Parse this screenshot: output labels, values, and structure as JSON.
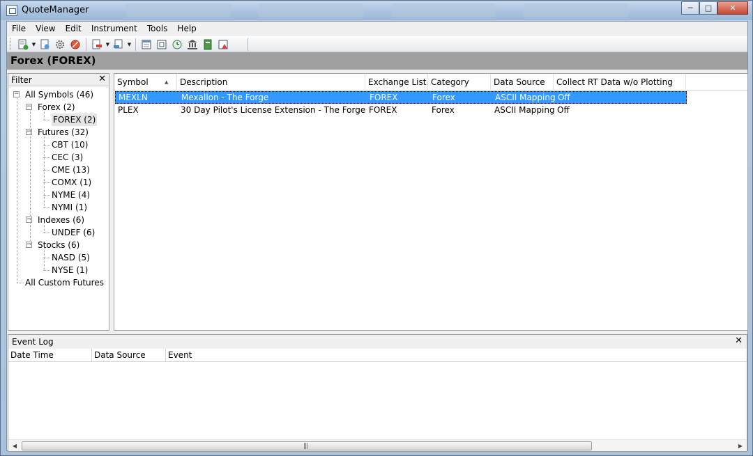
{
  "window": {
    "title": "QuoteManager",
    "minimize": "─",
    "maximize": "□",
    "close": "✕"
  },
  "menu": [
    "File",
    "View",
    "Edit",
    "Instrument",
    "Tools",
    "Help"
  ],
  "toolbar": {
    "icons": [
      "new-symbol-icon",
      "dropdown-arrow",
      "import-icon",
      "settings-gear-icon",
      "stop-icon",
      "export-icon",
      "dropdown-arrow",
      "download-icon",
      "dropdown-arrow",
      "calendar-icon",
      "session-icon",
      "clock-icon",
      "exchange-icon",
      "book-icon",
      "chart-alert-icon"
    ]
  },
  "header": {
    "title": "Forex (FOREX)"
  },
  "filter": {
    "label": "Filter",
    "close": "✕",
    "tree": [
      {
        "label": "All Symbols (46)",
        "level": 0,
        "expander": "−"
      },
      {
        "label": "Forex (2)",
        "level": 1,
        "expander": "−"
      },
      {
        "label": "FOREX (2)",
        "level": 2,
        "selected": true
      },
      {
        "label": "Futures (32)",
        "level": 1,
        "expander": "−"
      },
      {
        "label": "CBT (10)",
        "level": 2
      },
      {
        "label": "CEC (3)",
        "level": 2
      },
      {
        "label": "CME (13)",
        "level": 2
      },
      {
        "label": "COMX (1)",
        "level": 2
      },
      {
        "label": "NYME (4)",
        "level": 2
      },
      {
        "label": "NYMI (1)",
        "level": 2
      },
      {
        "label": "Indexes (6)",
        "level": 1,
        "expander": "−"
      },
      {
        "label": "UNDEF (6)",
        "level": 2
      },
      {
        "label": "Stocks (6)",
        "level": 1,
        "expander": "−"
      },
      {
        "label": "NASD (5)",
        "level": 2
      },
      {
        "label": "NYSE (1)",
        "level": 2
      },
      {
        "label": "All Custom Futures",
        "level": 0
      }
    ]
  },
  "grid": {
    "sort_indicator": "▲",
    "columns": [
      "Symbol",
      "Description",
      "Exchange List...",
      "Category",
      "Data Source",
      "Collect RT Data w/o Plotting"
    ],
    "rows": [
      {
        "cells": [
          "MEXLN",
          "Mexallon - The Forge",
          "FOREX",
          "Forex",
          "ASCII Mapping",
          "Off"
        ],
        "selected": true
      },
      {
        "cells": [
          "PLEX",
          "30 Day Pilot's License Extension - The Forge",
          "FOREX",
          "Forex",
          "ASCII Mapping",
          "Off"
        ],
        "selected": false
      }
    ]
  },
  "eventlog": {
    "title": "Event Log",
    "close": "✕",
    "columns": [
      "Date Time",
      "Data Source",
      "Event"
    ],
    "scroll_left": "◀",
    "scroll_right": "▶",
    "scroll_grip": "|||"
  },
  "colors": {
    "selection": "#3399ff",
    "header_bar": "#a0a0a0"
  }
}
